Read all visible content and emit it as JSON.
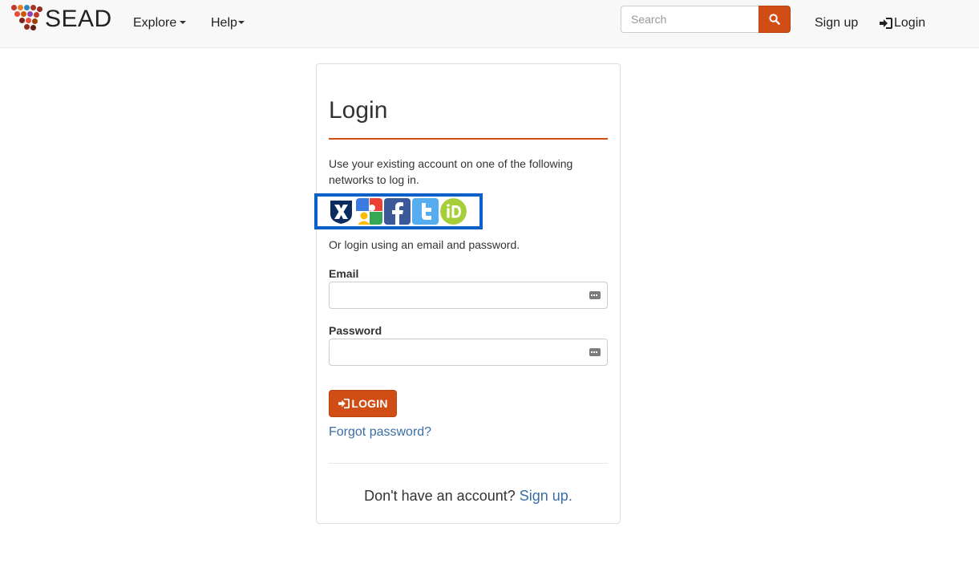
{
  "app": {
    "brand": "SEAD"
  },
  "nav": {
    "explore_label": "Explore",
    "help_label": "Help",
    "search_placeholder": "Search",
    "signup_label": "Sign up",
    "login_label": "Login"
  },
  "login_card": {
    "title": "Login",
    "intro_text": "Use your existing account on one of the following networks to log in.",
    "providers": [
      {
        "name": "CILogon",
        "icon": "cilogon-icon"
      },
      {
        "name": "Google",
        "icon": "google-icon"
      },
      {
        "name": "Facebook",
        "icon": "facebook-icon"
      },
      {
        "name": "Twitter",
        "icon": "twitter-icon"
      },
      {
        "name": "ORCID",
        "icon": "orcid-icon"
      }
    ],
    "alt_text": "Or login using an email and password.",
    "email_label": "Email",
    "email_value": "",
    "password_label": "Password",
    "password_value": "",
    "login_button_label": "LOGIN",
    "forgot_label": "Forgot password?",
    "no_account_text": "Don't have an account?",
    "signup_link_label": "Sign up."
  },
  "colors": {
    "accent": "#d04d15",
    "link": "#3a6ea5",
    "highlight_border": "#0a5fc8"
  }
}
